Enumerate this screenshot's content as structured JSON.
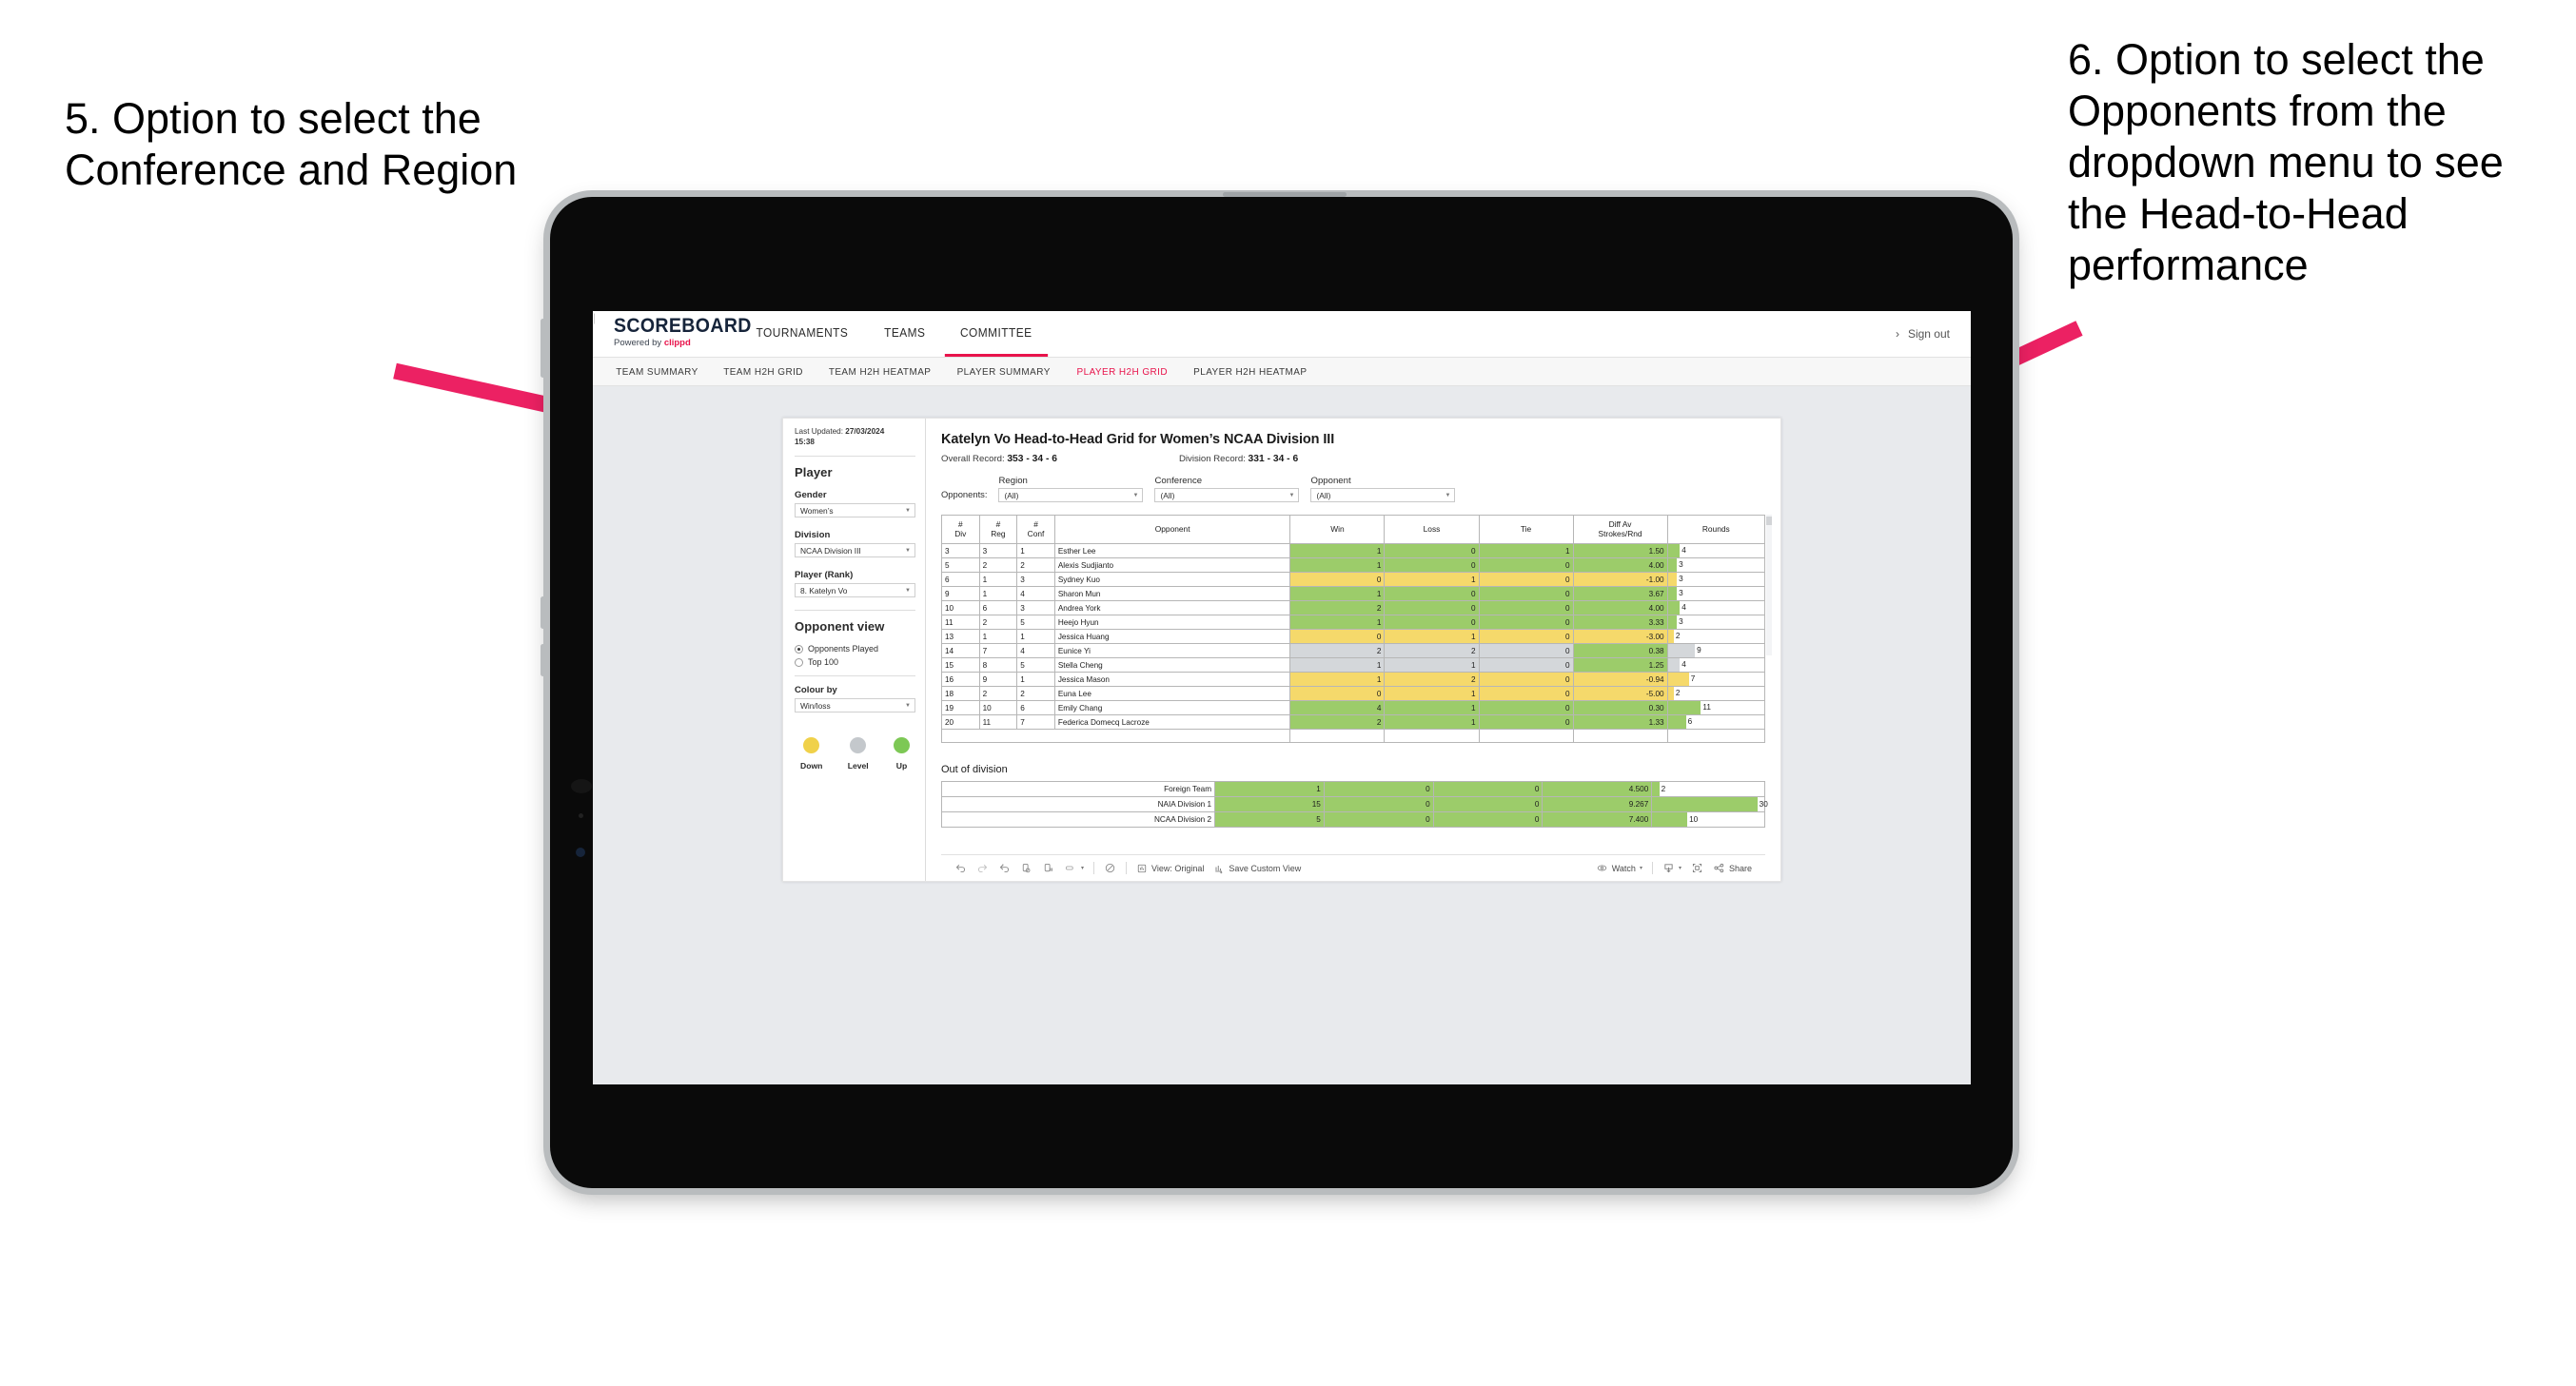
{
  "annotations": {
    "left": "5. Option to select the Conference and Region",
    "right": "6. Option to select the Opponents from the dropdown menu to see the Head-to-Head performance",
    "arrow_color": "#ec2163"
  },
  "topnav": {
    "brand_title": "SCOREBOARD",
    "brand_sub_prefix": "Powered by ",
    "brand_sub_brand": "clippd",
    "items": [
      {
        "label": "TOURNAMENTS",
        "active": false
      },
      {
        "label": "TEAMS",
        "active": false
      },
      {
        "label": "COMMITTEE",
        "active": true
      }
    ],
    "account_chevron": "›",
    "divider": "|",
    "sign_out": "Sign out"
  },
  "subnav": {
    "items": [
      {
        "label": "TEAM SUMMARY",
        "active": false
      },
      {
        "label": "TEAM H2H GRID",
        "active": false
      },
      {
        "label": "TEAM H2H HEATMAP",
        "active": false
      },
      {
        "label": "PLAYER SUMMARY",
        "active": false
      },
      {
        "label": "PLAYER H2H GRID",
        "active": true
      },
      {
        "label": "PLAYER H2H HEATMAP",
        "active": false
      }
    ],
    "active_color": "#e8134b"
  },
  "pane": {
    "last_updated_label": "Last Updated:",
    "last_updated_date": "27/03/2024",
    "last_updated_time": "15:38",
    "heading": "Player",
    "fields": [
      {
        "label": "Gender",
        "value": "Women’s"
      },
      {
        "label": "Division",
        "value": "NCAA Division III"
      },
      {
        "label": "Player (Rank)",
        "value": "8. Katelyn Vo"
      }
    ],
    "opponent_view_heading": "Opponent view",
    "opponent_view_options": [
      {
        "label": "Opponents Played",
        "selected": true
      },
      {
        "label": "Top 100",
        "selected": false
      }
    ],
    "colour_by_label": "Colour by",
    "colour_by_value": "Win/loss",
    "legend": [
      {
        "label": "Down",
        "color": "#f0d14a"
      },
      {
        "label": "Level",
        "color": "#c4c8cc"
      },
      {
        "label": "Up",
        "color": "#7dc855"
      }
    ]
  },
  "viz": {
    "title": "Katelyn Vo Head-to-Head Grid for Women’s NCAA Division III",
    "overall_record_label": "Overall Record:",
    "overall_record_value": "353 - 34 - 6",
    "division_record_label": "Division Record:",
    "division_record_value": "331 - 34 - 6",
    "opponents_label": "Opponents:",
    "filters": [
      {
        "label": "Region",
        "value": "(All)"
      },
      {
        "label": "Conference",
        "value": "(All)"
      },
      {
        "label": "Opponent",
        "value": "(All)"
      }
    ]
  },
  "chart_data": {
    "type": "table",
    "title": "Katelyn Vo Head-to-Head Grid for Women’s NCAA Division III",
    "columns": [
      "# Div",
      "# Reg",
      "# Conf",
      "Opponent",
      "Win",
      "Loss",
      "Tie",
      "Diff Av Strokes/Rnd",
      "Rounds"
    ],
    "rounds_max": 32,
    "colors": {
      "up": "#9ccc6a",
      "down": "#f5d96b",
      "level": "#d4d7da"
    },
    "rows": [
      {
        "div": "3",
        "reg": "3",
        "conf": "1",
        "opponent": "Esther Lee",
        "win": "1",
        "loss": "0",
        "tie": "1",
        "diff": "1.50",
        "rounds": "4",
        "tone": "up"
      },
      {
        "div": "5",
        "reg": "2",
        "conf": "2",
        "opponent": "Alexis Sudjianto",
        "win": "1",
        "loss": "0",
        "tie": "0",
        "diff": "4.00",
        "rounds": "3",
        "tone": "up"
      },
      {
        "div": "6",
        "reg": "1",
        "conf": "3",
        "opponent": "Sydney Kuo",
        "win": "0",
        "loss": "1",
        "tie": "0",
        "diff": "-1.00",
        "rounds": "3",
        "tone": "down"
      },
      {
        "div": "9",
        "reg": "1",
        "conf": "4",
        "opponent": "Sharon Mun",
        "win": "1",
        "loss": "0",
        "tie": "0",
        "diff": "3.67",
        "rounds": "3",
        "tone": "up"
      },
      {
        "div": "10",
        "reg": "6",
        "conf": "3",
        "opponent": "Andrea York",
        "win": "2",
        "loss": "0",
        "tie": "0",
        "diff": "4.00",
        "rounds": "4",
        "tone": "up"
      },
      {
        "div": "11",
        "reg": "2",
        "conf": "5",
        "opponent": "Heejo Hyun",
        "win": "1",
        "loss": "0",
        "tie": "0",
        "diff": "3.33",
        "rounds": "3",
        "tone": "up"
      },
      {
        "div": "13",
        "reg": "1",
        "conf": "1",
        "opponent": "Jessica Huang",
        "win": "0",
        "loss": "1",
        "tie": "0",
        "diff": "-3.00",
        "rounds": "2",
        "tone": "down"
      },
      {
        "div": "14",
        "reg": "7",
        "conf": "4",
        "opponent": "Eunice Yi",
        "win": "2",
        "loss": "2",
        "tie": "0",
        "diff": "0.38",
        "rounds": "9",
        "tone": "level",
        "diff_tone": "up"
      },
      {
        "div": "15",
        "reg": "8",
        "conf": "5",
        "opponent": "Stella Cheng",
        "win": "1",
        "loss": "1",
        "tie": "0",
        "diff": "1.25",
        "rounds": "4",
        "tone": "level",
        "diff_tone": "up"
      },
      {
        "div": "16",
        "reg": "9",
        "conf": "1",
        "opponent": "Jessica Mason",
        "win": "1",
        "loss": "2",
        "tie": "0",
        "diff": "-0.94",
        "rounds": "7",
        "tone": "down"
      },
      {
        "div": "18",
        "reg": "2",
        "conf": "2",
        "opponent": "Euna Lee",
        "win": "0",
        "loss": "1",
        "tie": "0",
        "diff": "-5.00",
        "rounds": "2",
        "tone": "down"
      },
      {
        "div": "19",
        "reg": "10",
        "conf": "6",
        "opponent": "Emily Chang",
        "win": "4",
        "loss": "1",
        "tie": "0",
        "diff": "0.30",
        "rounds": "11",
        "tone": "up"
      },
      {
        "div": "20",
        "reg": "11",
        "conf": "7",
        "opponent": "Federica Domecq Lacroze",
        "win": "2",
        "loss": "1",
        "tie": "0",
        "diff": "1.33",
        "rounds": "6",
        "tone": "up"
      }
    ]
  },
  "out_of_division": {
    "heading": "Out of division",
    "rounds_max": 32,
    "rows": [
      {
        "name": "Foreign Team",
        "win": "1",
        "loss": "0",
        "tie": "0",
        "diff": "4.500",
        "rounds": "2",
        "tone": "up"
      },
      {
        "name": "NAIA Division 1",
        "win": "15",
        "loss": "0",
        "tie": "0",
        "diff": "9.267",
        "rounds": "30",
        "tone": "up"
      },
      {
        "name": "NCAA Division 2",
        "win": "5",
        "loss": "0",
        "tie": "0",
        "diff": "7.400",
        "rounds": "10",
        "tone": "up"
      }
    ]
  },
  "toolbar": {
    "view_label": "View: Original",
    "save_label": "Save Custom View",
    "watch_label": "Watch",
    "share_label": "Share",
    "caret": "▾"
  }
}
